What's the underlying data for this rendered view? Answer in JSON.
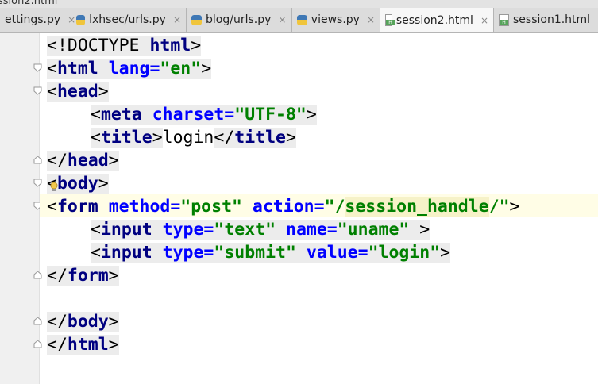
{
  "window": {
    "title_fragment": "ssion2.html"
  },
  "tabs": [
    {
      "label": "ettings.py",
      "icon": "python-file-icon",
      "active": false
    },
    {
      "label": "lxhsec/urls.py",
      "icon": "python-file-icon",
      "active": false
    },
    {
      "label": "blog/urls.py",
      "icon": "python-file-icon",
      "active": false
    },
    {
      "label": "views.py",
      "icon": "python-file-icon",
      "active": false
    },
    {
      "label": "session2.html",
      "icon": "html-file-icon",
      "active": true
    },
    {
      "label": "session1.html",
      "icon": "html-file-icon",
      "active": false
    }
  ],
  "close_glyph": "×",
  "code": {
    "doctype": {
      "open": "<!DOCTYPE",
      "name": "html",
      "close": ">"
    },
    "html_open": {
      "lt": "<",
      "tag": "html",
      "attr": "lang=",
      "val": "\"en\"",
      "gt": ">"
    },
    "head_open": {
      "lt": "<",
      "tag": "head",
      "gt": ">"
    },
    "meta": {
      "lt": "<",
      "tag": "meta",
      "attr": "charset=",
      "val": "\"UTF-8\"",
      "gt": ">"
    },
    "title_line": {
      "lt": "<",
      "tag": "title",
      "gt": ">",
      "text": "login",
      "lt2": "</",
      "tag2": "title",
      "gt2": ">"
    },
    "head_close": {
      "lt": "</",
      "tag": "head",
      "gt": ">"
    },
    "body_open": {
      "lt": "<",
      "tag": "body",
      "gt": ">"
    },
    "form_open": {
      "lt": "<",
      "tag": "form",
      "attr1": "method=",
      "val1": "\"post\"",
      "attr2": "action=",
      "q1": "\"/",
      "val2": "session_handle",
      "q2": "/\"",
      "gt": ">"
    },
    "input1": {
      "lt": "<",
      "tag": "input",
      "attr1": "type=",
      "val1": "\"text\"",
      "attr2": "name=",
      "val2": "\"uname\"",
      "gt": " >"
    },
    "input2": {
      "lt": "<",
      "tag": "input",
      "attr1": "type=",
      "val1": "\"submit\"",
      "attr2": "value=",
      "val2": "\"login\"",
      "gt": ">"
    },
    "form_close": {
      "lt": "</",
      "tag": "form",
      "gt": ">"
    },
    "body_close": {
      "lt": "</",
      "tag": "body",
      "gt": ">"
    },
    "html_close": {
      "lt": "</",
      "tag": "html",
      "gt": ">"
    }
  },
  "colors": {
    "tag": "#000080",
    "attribute": "#0000ff",
    "string": "#008000",
    "caret_line": "#fffde6",
    "gutter": "#f0f0f0"
  }
}
